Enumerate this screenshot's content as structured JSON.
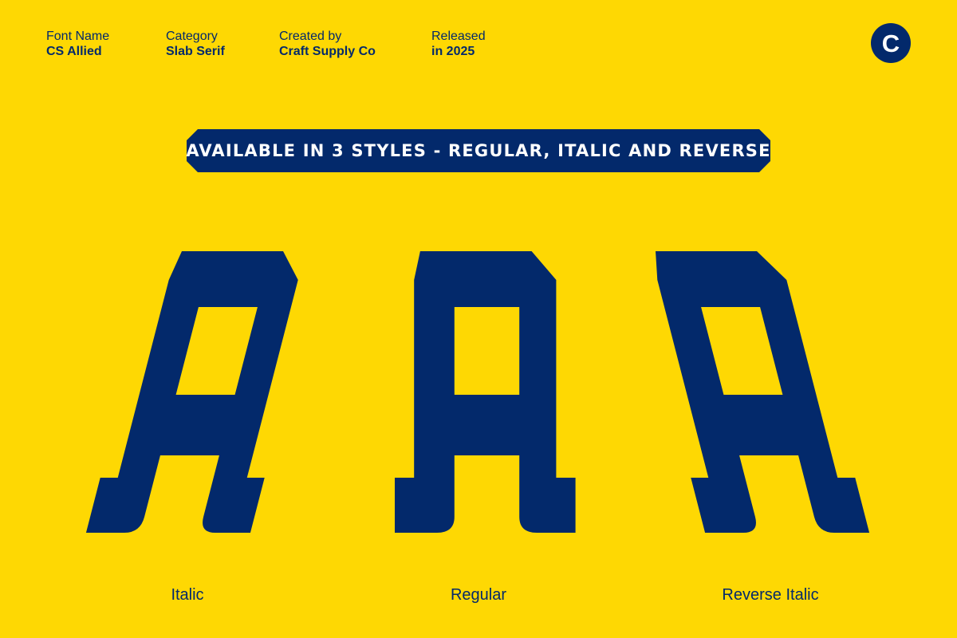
{
  "colors": {
    "background": "#fed803",
    "navy": "#03296b"
  },
  "meta": [
    {
      "label": "Font Name",
      "value": "CS Allied"
    },
    {
      "label": "Category",
      "value": "Slab Serif"
    },
    {
      "label": "Created by",
      "value": "Craft Supply Co"
    },
    {
      "label": "Released",
      "value": "in 2025"
    }
  ],
  "logo": {
    "letter": "C",
    "icon": "circle-c-logo-icon"
  },
  "banner": {
    "text": "AVAILABLE IN 3 STYLES - REGULAR, ITALIC AND REVERSE"
  },
  "specimens": [
    {
      "style": "Italic",
      "glyph": "A"
    },
    {
      "style": "Regular",
      "glyph": "A"
    },
    {
      "style": "Reverse Italic",
      "glyph": "A"
    }
  ]
}
